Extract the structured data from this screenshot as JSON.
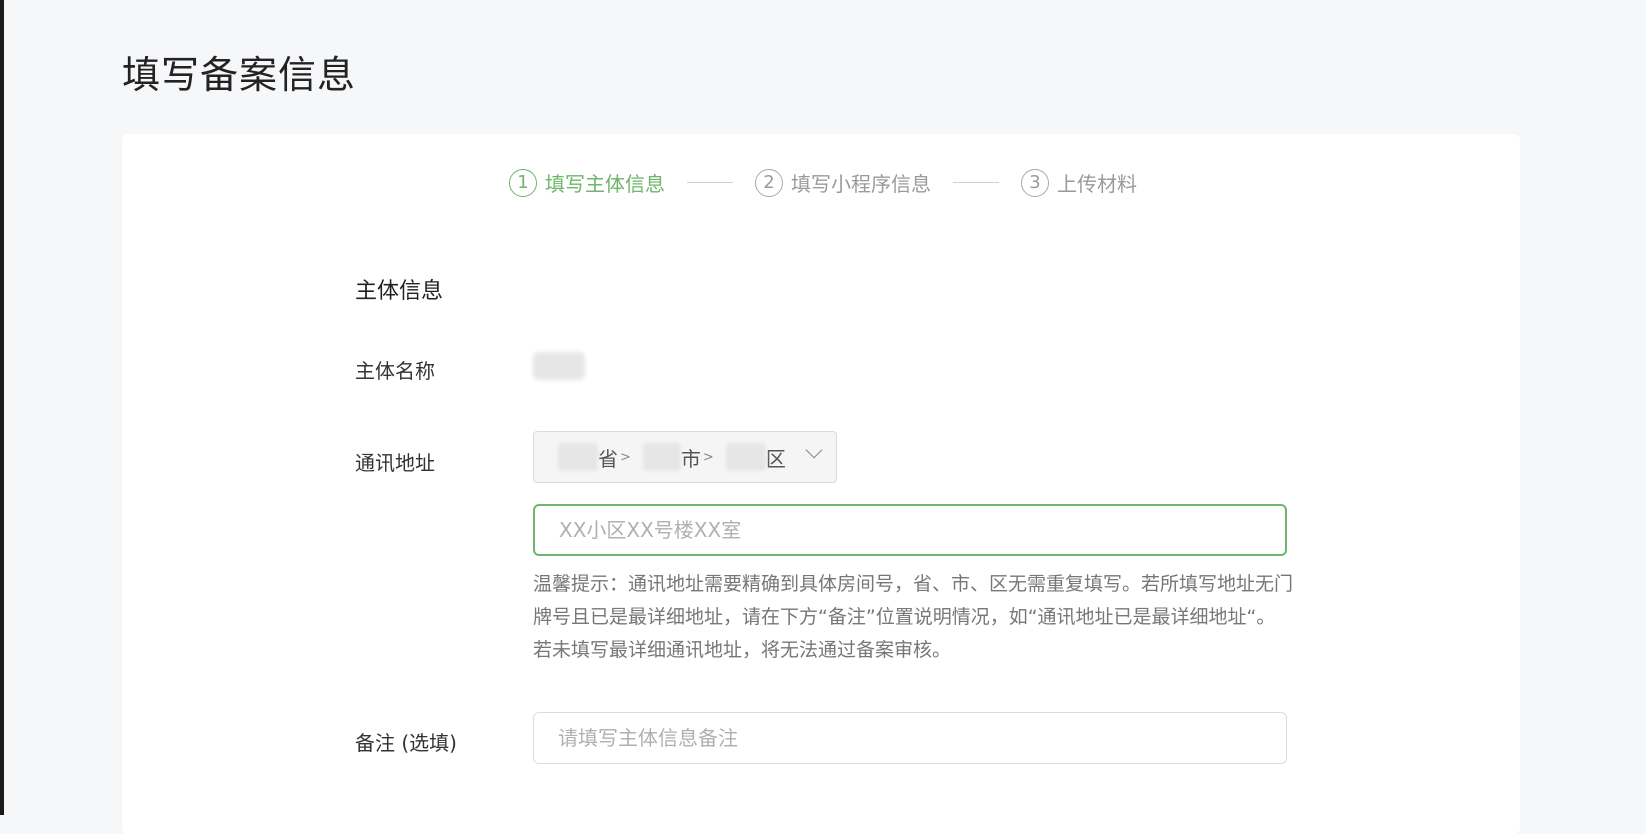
{
  "page": {
    "title": "填写备案信息"
  },
  "steps": [
    {
      "num": "1",
      "label": "填写主体信息",
      "active": true
    },
    {
      "num": "2",
      "label": "填写小程序信息",
      "active": false
    },
    {
      "num": "3",
      "label": "上传材料",
      "active": false
    }
  ],
  "section": {
    "title": "主体信息"
  },
  "fields": {
    "entity_name": {
      "label": "主体名称"
    },
    "address": {
      "label": "通讯地址",
      "province_suffix": "省",
      "city_suffix": "市",
      "district_suffix": "区",
      "detail_placeholder": "XX小区XX号楼XX室",
      "hint": "温馨提示：通讯地址需要精确到具体房间号，省、市、区无需重复填写。若所填写地址无门牌号且已是最详细地址，请在下方“备注”位置说明情况，如“通讯地址已是最详细地址“。若未填写最详细通讯地址，将无法通过备案审核。"
    },
    "remark": {
      "label": "备注 (选填)",
      "placeholder": "请填写主体信息备注"
    }
  },
  "colors": {
    "accent": "#6fb56c"
  }
}
